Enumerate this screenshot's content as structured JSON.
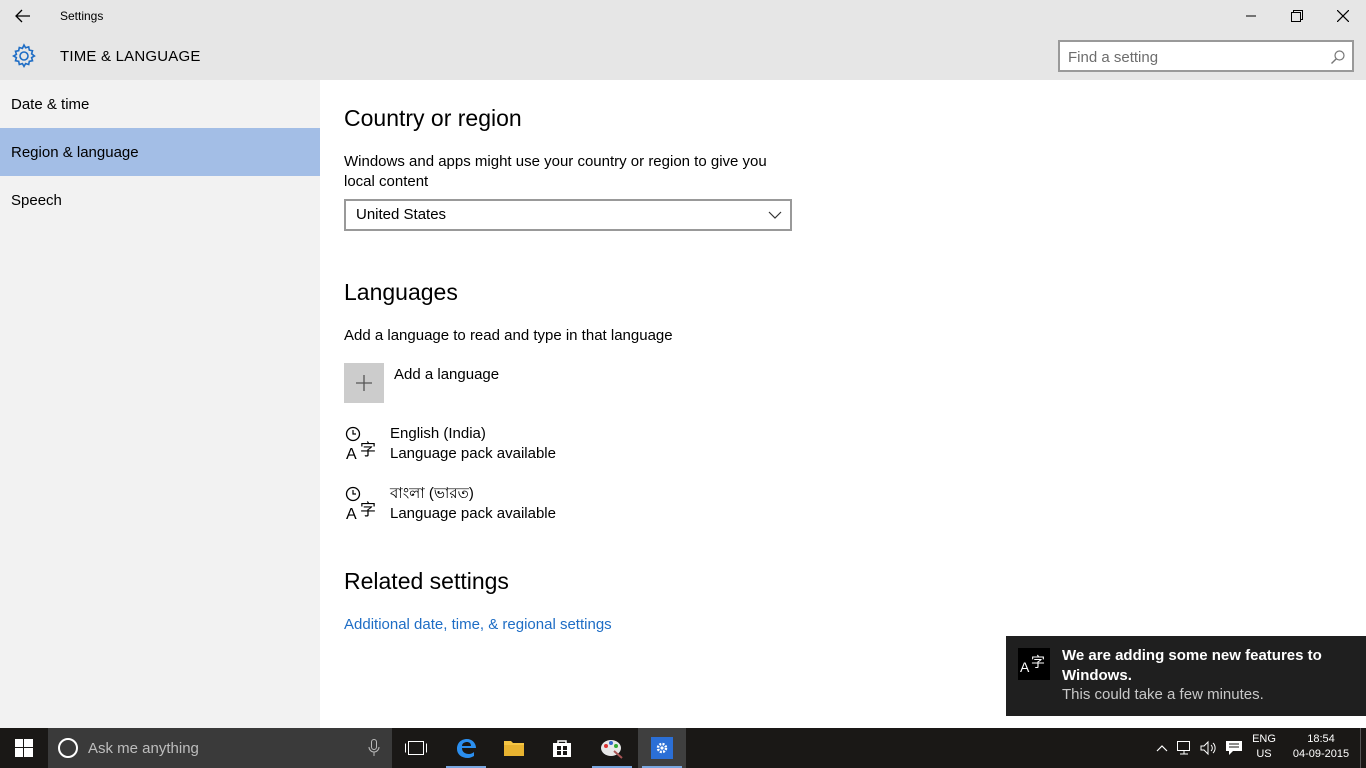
{
  "window": {
    "title": "Settings",
    "controls": {
      "minimize": "minimize",
      "restore": "restore",
      "close": "close"
    }
  },
  "header": {
    "section_title": "TIME & LANGUAGE",
    "search_placeholder": "Find a setting"
  },
  "sidebar": {
    "items": [
      {
        "label": "Date & time",
        "active": false
      },
      {
        "label": "Region & language",
        "active": true
      },
      {
        "label": "Speech",
        "active": false
      }
    ]
  },
  "main": {
    "country": {
      "heading": "Country or region",
      "description": "Windows and apps might use your country or region to give you local content",
      "selected": "United States"
    },
    "languages": {
      "heading": "Languages",
      "description": "Add a language to read and type in that language",
      "add_label": "Add a language",
      "items": [
        {
          "name": "English (India)",
          "status": "Language pack available"
        },
        {
          "name": "বাংলা (ভারত)",
          "status": "Language pack available"
        }
      ]
    },
    "related": {
      "heading": "Related settings",
      "link": "Additional date, time, & regional settings"
    }
  },
  "toast": {
    "title": "We are adding some new features to Windows.",
    "body": "This could take a few minutes."
  },
  "taskbar": {
    "search_placeholder": "Ask me anything",
    "apps": [
      "task-view",
      "edge",
      "file-explorer",
      "store",
      "paint",
      "settings"
    ],
    "tray": {
      "lang_top": "ENG",
      "lang_bottom": "US",
      "time": "18:54",
      "date": "04-09-2015"
    }
  },
  "colors": {
    "accent": "#1e6dc5",
    "sidebar_active": "#a3bee6",
    "header_bg": "#e6e6e6",
    "sidebar_bg": "#f2f2f2",
    "taskbar_bg": "#1a1816"
  }
}
